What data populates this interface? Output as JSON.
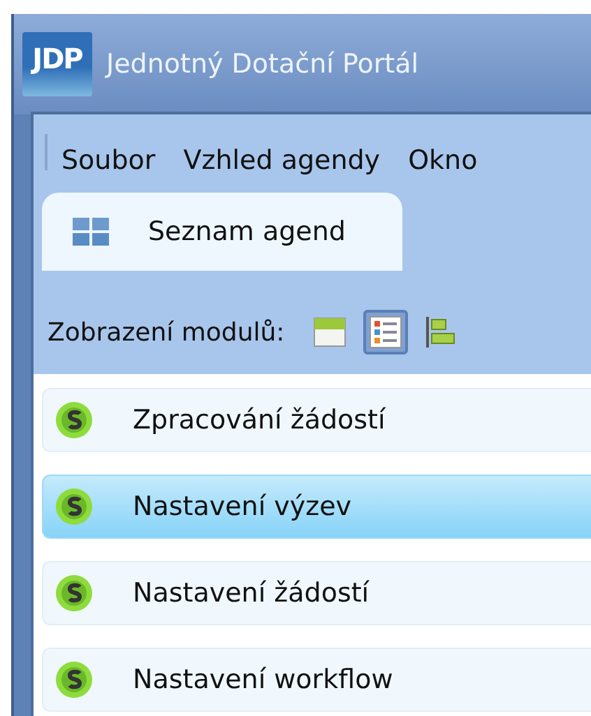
{
  "window": {
    "logo": "JDP",
    "title": "Jednotný Dotační Portál"
  },
  "menu": [
    "Soubor",
    "Vzhled agendy",
    "Okno"
  ],
  "tabs": [
    {
      "label": "Seznam agend",
      "selected": true
    }
  ],
  "toolbar": {
    "label": "Zobrazení modulů:",
    "view_modes": [
      {
        "kind": "tiles",
        "selected": false
      },
      {
        "kind": "list",
        "selected": true
      },
      {
        "kind": "tree",
        "selected": false
      }
    ]
  },
  "modules": [
    {
      "label": "Zpracování žádostí",
      "selected": false
    },
    {
      "label": "Nastavení výzev",
      "selected": true
    },
    {
      "label": "Nastavení žádostí",
      "selected": false
    },
    {
      "label": "Nastavení workflow",
      "selected": false
    }
  ]
}
